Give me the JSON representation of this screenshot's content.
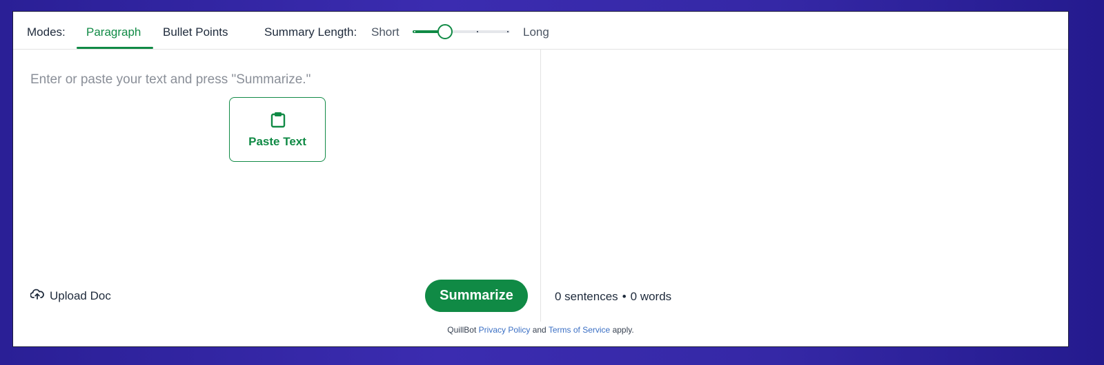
{
  "toolbar": {
    "modes_label": "Modes:",
    "tabs": [
      {
        "label": "Paragraph",
        "active": true
      },
      {
        "label": "Bullet Points",
        "active": false
      }
    ],
    "summary_length_label": "Summary Length:",
    "short_label": "Short",
    "long_label": "Long",
    "slider_value_fraction": 0.33
  },
  "input": {
    "placeholder": "Enter or paste your text and press \"Summarize.\"",
    "paste_button_label": "Paste Text",
    "paste_icon": "clipboard-icon",
    "upload_label": "Upload Doc",
    "upload_icon": "cloud-upload-icon",
    "summarize_label": "Summarize"
  },
  "output": {
    "sentences_count": "0 sentences",
    "separator": "•",
    "words_count": "0 words"
  },
  "footer": {
    "prefix": "QuillBot",
    "privacy_link": "Privacy Policy",
    "and": "and",
    "terms_link": "Terms of Service",
    "suffix": "apply."
  },
  "colors": {
    "accent": "#108a45",
    "background_gradient_start": "#2a1f96",
    "background_gradient_end": "#241a8e",
    "link": "#3a6fc4"
  }
}
